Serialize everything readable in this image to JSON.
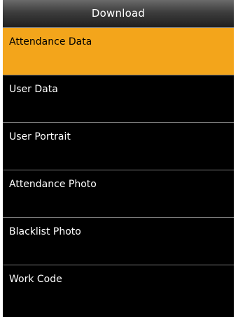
{
  "header": {
    "title": "Download"
  },
  "menu": {
    "items": [
      {
        "label": "Attendance Data",
        "selected": true
      },
      {
        "label": "User Data",
        "selected": false
      },
      {
        "label": "User Portrait",
        "selected": false
      },
      {
        "label": "Attendance Photo",
        "selected": false
      },
      {
        "label": "Blacklist Photo",
        "selected": false
      },
      {
        "label": "Work Code",
        "selected": false
      }
    ]
  },
  "colors": {
    "selected_background": "#f3a51b",
    "background": "#000000",
    "text": "#ffffff",
    "divider": "#7a7a7a"
  }
}
